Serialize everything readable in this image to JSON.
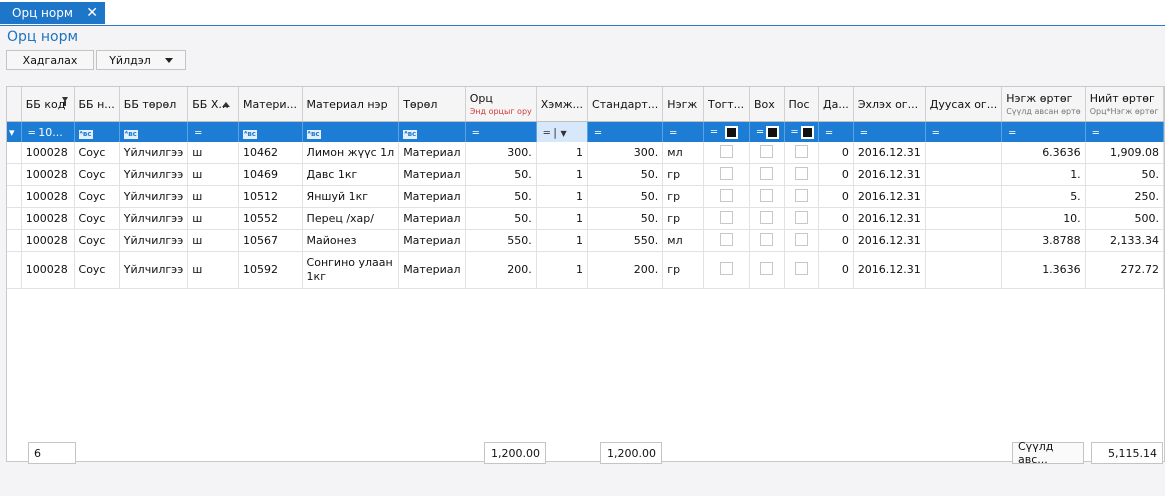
{
  "tab": {
    "label": "Орц норм",
    "close": "✕"
  },
  "page": {
    "title": "Орц норм"
  },
  "toolbar": {
    "save_label": "Хадгалах",
    "actions_label": "Үйлдэл"
  },
  "grid": {
    "headers": {
      "bb_code": "ББ код",
      "bb_name": "ББ н...",
      "bb_type": "ББ төрөл",
      "bb_unit": "ББ Х...",
      "material_code": "Матери...",
      "material_name": "Материал нэр",
      "type": "Төрөл",
      "orts": "Орц",
      "orts_sub": "Энд орцыг ору",
      "unit_measure": "Хэмж...",
      "standard": "Стандарт...",
      "unit": "Нэгж",
      "togt": "Тогт...",
      "vox": "Вох",
      "pos": "Пос",
      "da": "Да...",
      "start_date": "Эхлэх ог...",
      "end_date": "Дуусах ог...",
      "unit_cost": "Нэгж өртөг",
      "unit_cost_sub": "Сүүлд авсан өртө",
      "total_cost": "Нийт өртөг",
      "total_cost_sub": "Орц*Нэгж өртөг"
    },
    "filter": {
      "bb_code": "10..."
    },
    "rows": [
      {
        "bb_code": "100028",
        "bb_name": "Соус",
        "bb_type": "Үйлчилгээ",
        "bb_unit": "ш",
        "material_code": "10462",
        "material_name": "Лимон жүүс 1л",
        "type": "Материал",
        "orts": "300.",
        "measure": "1",
        "standard": "300.",
        "unit": "мл",
        "da": "0",
        "start": "2016.12.31",
        "end": "",
        "unit_cost": "6.3636",
        "total": "1,909.08"
      },
      {
        "bb_code": "100028",
        "bb_name": "Соус",
        "bb_type": "Үйлчилгээ",
        "bb_unit": "ш",
        "material_code": "10469",
        "material_name": "Давс 1кг",
        "type": "Материал",
        "orts": "50.",
        "measure": "1",
        "standard": "50.",
        "unit": "гр",
        "da": "0",
        "start": "2016.12.31",
        "end": "",
        "unit_cost": "1.",
        "total": "50."
      },
      {
        "bb_code": "100028",
        "bb_name": "Соус",
        "bb_type": "Үйлчилгээ",
        "bb_unit": "ш",
        "material_code": "10512",
        "material_name": "Яншуй 1кг",
        "type": "Материал",
        "orts": "50.",
        "measure": "1",
        "standard": "50.",
        "unit": "гр",
        "da": "0",
        "start": "2016.12.31",
        "end": "",
        "unit_cost": "5.",
        "total": "250."
      },
      {
        "bb_code": "100028",
        "bb_name": "Соус",
        "bb_type": "Үйлчилгээ",
        "bb_unit": "ш",
        "material_code": "10552",
        "material_name": "Перец /хар/",
        "type": "Материал",
        "orts": "50.",
        "measure": "1",
        "standard": "50.",
        "unit": "гр",
        "da": "0",
        "start": "2016.12.31",
        "end": "",
        "unit_cost": "10.",
        "total": "500."
      },
      {
        "bb_code": "100028",
        "bb_name": "Соус",
        "bb_type": "Үйлчилгээ",
        "bb_unit": "ш",
        "material_code": "10567",
        "material_name": "Майонез",
        "type": "Материал",
        "orts": "550.",
        "measure": "1",
        "standard": "550.",
        "unit": "мл",
        "da": "0",
        "start": "2016.12.31",
        "end": "",
        "unit_cost": "3.8788",
        "total": "2,133.34"
      },
      {
        "bb_code": "100028",
        "bb_name": "Соус",
        "bb_type": "Үйлчилгээ",
        "bb_unit": "ш",
        "material_code": "10592",
        "material_name": "Сонгино улаан 1кг",
        "type": "Материал",
        "orts": "200.",
        "measure": "1",
        "standard": "200.",
        "unit": "гр",
        "da": "0",
        "start": "2016.12.31",
        "end": "",
        "unit_cost": "1.3636",
        "total": "272.72"
      }
    ]
  },
  "footer": {
    "count": "6",
    "orts_total": "1,200.00",
    "standard_total": "1,200.00",
    "last_cost_label": "Сүүлд авс...",
    "grand_total": "5,115.14"
  }
}
